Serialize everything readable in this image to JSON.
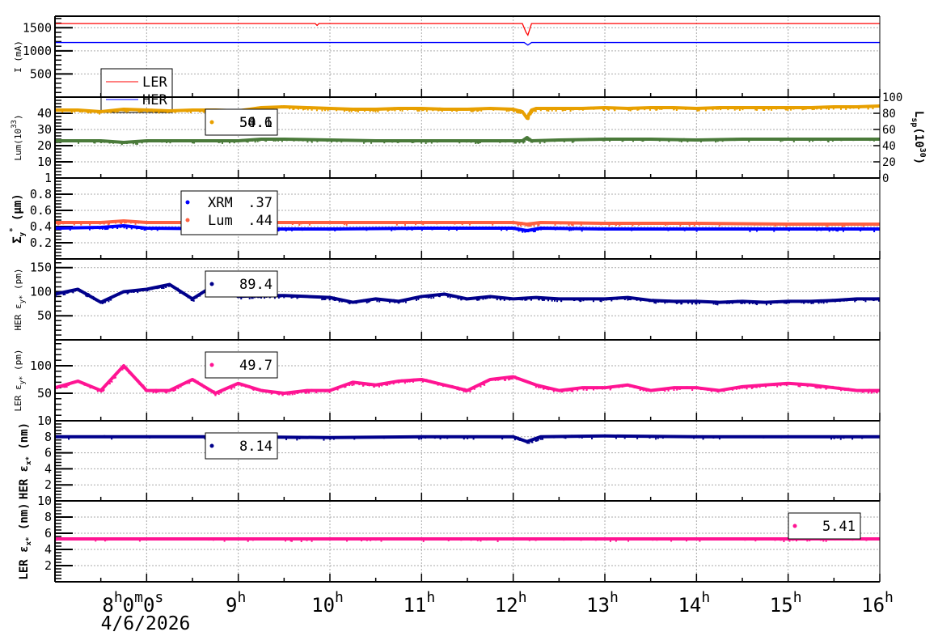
{
  "chart_data": {
    "type": "scatter",
    "xlim_hours": [
      7,
      16
    ],
    "x_tick_labels": [
      {
        "hour": 8,
        "base": "8",
        "sup": [
          "h",
          "0",
          "m",
          "0",
          "s"
        ]
      },
      {
        "hour": 9,
        "base": "9",
        "sup": [
          "h"
        ]
      },
      {
        "hour": 10,
        "base": "10",
        "sup": [
          "h"
        ]
      },
      {
        "hour": 11,
        "base": "11",
        "sup": [
          "h"
        ]
      },
      {
        "hour": 12,
        "base": "12",
        "sup": [
          "h"
        ]
      },
      {
        "hour": 13,
        "base": "13",
        "sup": [
          "h"
        ]
      },
      {
        "hour": 14,
        "base": "14",
        "sup": [
          "h"
        ]
      },
      {
        "hour": 15,
        "base": "15",
        "sup": [
          "h"
        ]
      },
      {
        "hour": 16,
        "base": "16",
        "sup": [
          "h"
        ]
      }
    ],
    "x8_label_parts": [
      "8",
      "h",
      "0",
      "m",
      "0",
      "s"
    ],
    "date_label": "4/6/2026",
    "grid": true,
    "panels": [
      {
        "id": "current",
        "ylabel": "I (mA)",
        "ylim": [
          0,
          1750
        ],
        "yticks": [
          500,
          1000,
          1500
        ],
        "ytick_labels": [
          "500",
          "1000",
          "1500"
        ],
        "legend": {
          "placement": "left",
          "entries": [
            {
              "label": "LER",
              "color": "#ff0000"
            },
            {
              "label": "HER",
              "color": "#0000ff"
            }
          ]
        },
        "series": [
          {
            "name": "LER",
            "color": "#ff0000",
            "style": "line",
            "x": [
              7,
              9.84,
              9.86,
              9.88,
              12.1,
              12.14,
              12.16,
              12.2,
              16
            ],
            "y": [
              1590,
              1590,
              1550,
              1590,
              1590,
              1400,
              1340,
              1590,
              1590
            ]
          },
          {
            "name": "HER",
            "color": "#0000ff",
            "style": "line",
            "x": [
              7,
              12.12,
              12.16,
              12.2,
              16
            ],
            "y": [
              1180,
              1180,
              1125,
              1180,
              1180
            ]
          }
        ]
      },
      {
        "id": "luminosity",
        "ylabel": "Lum(10",
        "ylabel_sup": "33",
        "ylabel_end": ")",
        "ylim": [
          0,
          50
        ],
        "yticks": [
          10,
          20,
          30,
          40
        ],
        "ytick_labels": [
          "10",
          "20",
          "30",
          "40"
        ],
        "right_axis": {
          "label": "L",
          "label_sub": "sp",
          "label_mid": "(10",
          "label_sup": "30",
          "label_end": ")",
          "ylim": [
            0,
            100
          ],
          "ticks": [
            0,
            20,
            40,
            60,
            80,
            100
          ],
          "tick_labels": [
            "0",
            "20",
            "40",
            "60",
            "80",
            "100"
          ]
        },
        "legend": {
          "placement": "top-left",
          "values": [
            "50.1",
            "54.6"
          ],
          "color": "#e8a000"
        },
        "series": [
          {
            "name": "Lum",
            "color": "#e8a000",
            "style": "band",
            "x": [
              7,
              7.25,
              7.5,
              7.75,
              8,
              8.25,
              8.5,
              8.75,
              9,
              9.25,
              9.5,
              9.75,
              10,
              10.25,
              10.5,
              10.75,
              11,
              11.25,
              11.5,
              11.75,
              12,
              12.1,
              12.15,
              12.2,
              12.25,
              12.5,
              12.75,
              13,
              13.25,
              13.5,
              13.75,
              14,
              14.25,
              14.5,
              14.75,
              15,
              15.25,
              15.5,
              15.75,
              16
            ],
            "y": [
              42,
              42,
              41,
              42.5,
              42,
              41.5,
              42,
              42,
              41.5,
              43.5,
              44,
              43.5,
              43,
              42.5,
              42.5,
              43,
              43,
              42.5,
              42.5,
              43,
              42.5,
              41,
              37,
              42,
              43,
              43,
              43,
              43.5,
              43,
              43.5,
              43.5,
              43,
              43.5,
              43.5,
              43.5,
              43.5,
              43.5,
              44,
              44,
              44.5
            ]
          },
          {
            "name": "Lsp",
            "color": "#4a7a3a",
            "style": "band",
            "x": [
              7,
              7.5,
              7.75,
              8,
              8.5,
              9,
              9.25,
              9.5,
              10,
              10.5,
              11,
              11.5,
              12,
              12.1,
              12.15,
              12.2,
              12.5,
              13,
              13.5,
              14,
              14.5,
              15,
              15.5,
              16
            ],
            "y": [
              23,
              23,
              22,
              23,
              23,
              23,
              24,
              24,
              23.5,
              23,
              23,
              23,
              23,
              23,
              25,
              23,
              23.5,
              24,
              24,
              23.5,
              24,
              24,
              24,
              24
            ]
          }
        ]
      },
      {
        "id": "sigma_y",
        "ylabel": "Σ",
        "ylabel_sub": "y",
        "ylabel_sup": "*",
        "ylabel_end": " (μm)",
        "ylim": [
          0,
          1
        ],
        "yticks": [
          0.2,
          0.4,
          0.6,
          0.8,
          1
        ],
        "ytick_labels": [
          "0.2",
          "0.4",
          "0.6",
          "0.8",
          "1"
        ],
        "legend": {
          "placement": "top-left",
          "entries": [
            {
              "label": "XRM",
              "value": ".37",
              "color": "#0000ff"
            },
            {
              "label": "Lum",
              "value": ".44",
              "color": "#ff6040"
            }
          ]
        },
        "series": [
          {
            "name": "Lum",
            "color": "#ff6040",
            "style": "band",
            "x": [
              7,
              7.5,
              7.75,
              8,
              9,
              10,
              11,
              12,
              12.15,
              12.3,
              13,
              14,
              15,
              16
            ],
            "y": [
              0.45,
              0.45,
              0.47,
              0.45,
              0.45,
              0.45,
              0.45,
              0.45,
              0.43,
              0.45,
              0.44,
              0.44,
              0.43,
              0.43
            ]
          },
          {
            "name": "XRM",
            "color": "#0000ff",
            "style": "band",
            "x": [
              7,
              7.5,
              7.75,
              8,
              9,
              10,
              11,
              12,
              12.15,
              12.3,
              13,
              14,
              15,
              16
            ],
            "y": [
              0.38,
              0.39,
              0.41,
              0.38,
              0.37,
              0.37,
              0.38,
              0.38,
              0.35,
              0.38,
              0.37,
              0.37,
              0.37,
              0.37
            ]
          }
        ]
      },
      {
        "id": "her_ey",
        "ylabel": "HER ε",
        "ylabel_sub": "y*",
        "ylabel_end": " (pm)",
        "ylim": [
          0,
          168
        ],
        "yticks": [
          50,
          100,
          150
        ],
        "ytick_labels": [
          "50",
          "100",
          "150"
        ],
        "legend": {
          "placement": "top-left",
          "value": "89.4",
          "color": "#00008b"
        },
        "series": [
          {
            "name": "HER εy*",
            "color": "#00008b",
            "style": "band",
            "x": [
              7,
              7.25,
              7.5,
              7.75,
              8,
              8.25,
              8.5,
              8.75,
              9,
              9.25,
              9.5,
              9.75,
              10,
              10.25,
              10.5,
              10.75,
              11,
              11.25,
              11.5,
              11.75,
              12,
              12.25,
              12.5,
              12.75,
              13,
              13.25,
              13.5,
              13.75,
              14,
              14.25,
              14.5,
              14.75,
              15,
              15.25,
              15.5,
              15.75,
              16
            ],
            "y": [
              95,
              105,
              78,
              100,
              105,
              115,
              85,
              115,
              90,
              92,
              92,
              90,
              88,
              78,
              85,
              80,
              90,
              95,
              85,
              90,
              85,
              88,
              85,
              85,
              85,
              88,
              82,
              80,
              80,
              78,
              80,
              78,
              80,
              80,
              82,
              85,
              85
            ]
          }
        ]
      },
      {
        "id": "ler_ey",
        "ylabel": "LER ε",
        "ylabel_sub": "y*",
        "ylabel_end": " (pm)",
        "ylim": [
          0,
          147
        ],
        "yticks": [
          50,
          100
        ],
        "ytick_labels": [
          "50",
          "100"
        ],
        "legend": {
          "placement": "top-left",
          "value": "49.7",
          "color": "#ff1493"
        },
        "series": [
          {
            "name": "LER εy*",
            "color": "#ff1493",
            "style": "band",
            "x": [
              7,
              7.25,
              7.5,
              7.75,
              8,
              8.25,
              8.5,
              8.75,
              9,
              9.25,
              9.5,
              9.75,
              10,
              10.25,
              10.5,
              10.75,
              11,
              11.25,
              11.5,
              11.75,
              12,
              12.25,
              12.5,
              12.75,
              13,
              13.25,
              13.5,
              13.75,
              14,
              14.25,
              14.5,
              14.75,
              15,
              15.25,
              15.5,
              15.75,
              16
            ],
            "y": [
              60,
              72,
              55,
              100,
              55,
              55,
              75,
              50,
              68,
              55,
              50,
              55,
              55,
              70,
              65,
              72,
              75,
              65,
              55,
              75,
              80,
              65,
              55,
              60,
              60,
              65,
              55,
              60,
              60,
              55,
              62,
              65,
              68,
              65,
              60,
              55,
              55
            ]
          }
        ]
      },
      {
        "id": "her_ex",
        "ylabel": "HER ε",
        "ylabel_sub": "x*",
        "ylabel_end": " (nm)",
        "ylim": [
          0,
          10
        ],
        "yticks": [
          2,
          4,
          6,
          8,
          10
        ],
        "ytick_labels": [
          "2",
          "4",
          "6",
          "8",
          "10"
        ],
        "legend": {
          "placement": "top-left",
          "value": "8.14",
          "color": "#00008b"
        },
        "series": [
          {
            "name": "HER εx*",
            "color": "#00008b",
            "style": "band",
            "x": [
              7,
              9,
              10,
              11,
              12,
              12.15,
              12.3,
              13,
              14,
              15,
              16
            ],
            "y": [
              8,
              8,
              7.9,
              8,
              8,
              7.4,
              8,
              8.1,
              8,
              8,
              8
            ]
          }
        ]
      },
      {
        "id": "ler_ex",
        "ylabel": "LER ε",
        "ylabel_sub": "x*",
        "ylabel_end": " (nm)",
        "ylim": [
          0,
          10
        ],
        "yticks": [
          2,
          4,
          6,
          8,
          10
        ],
        "ytick_labels": [
          "2",
          "4",
          "6",
          "8",
          "10"
        ],
        "legend": {
          "placement": "right",
          "value": "5.41",
          "color": "#ff1493"
        },
        "series": [
          {
            "name": "LER εx*",
            "color": "#ff1493",
            "style": "band",
            "x": [
              7,
              9,
              10,
              11,
              12,
              13,
              14,
              15,
              16
            ],
            "y": [
              5.3,
              5.3,
              5.3,
              5.3,
              5.3,
              5.3,
              5.3,
              5.3,
              5.3
            ]
          }
        ]
      }
    ]
  }
}
